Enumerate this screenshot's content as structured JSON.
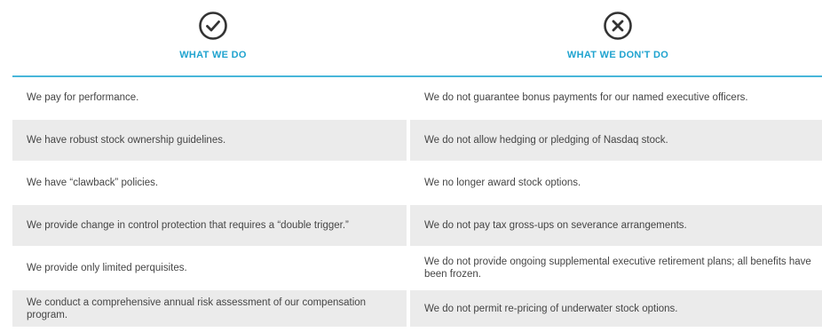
{
  "header": {
    "do": {
      "label": "WHAT WE DO",
      "icon": "checkmark-circle-icon"
    },
    "dont": {
      "label": "WHAT WE DON'T DO",
      "icon": "x-circle-icon"
    }
  },
  "colors": {
    "accent": "#1fa3cf",
    "rule": "#48b6da",
    "row_shade": "#ebebeb",
    "text": "#454545"
  },
  "rows": [
    {
      "do": "We pay for performance.",
      "dont": "We do not guarantee bonus payments for our named executive officers."
    },
    {
      "do": "We have robust stock ownership guidelines.",
      "dont": "We do not allow hedging or pledging of Nasdaq stock."
    },
    {
      "do": "We have “clawback” policies.",
      "dont": "We no longer award stock options."
    },
    {
      "do": "We provide change in control protection that requires a “double trigger.”",
      "dont": "We do not pay tax gross-ups on severance arrangements."
    },
    {
      "do": "We provide only limited perquisites.",
      "dont": "We do not provide ongoing supplemental executive retirement plans; all benefits have been frozen."
    },
    {
      "do": "We conduct a comprehensive annual risk assessment of our compensation program.",
      "dont": "We do not permit re-pricing of underwater stock options."
    }
  ]
}
